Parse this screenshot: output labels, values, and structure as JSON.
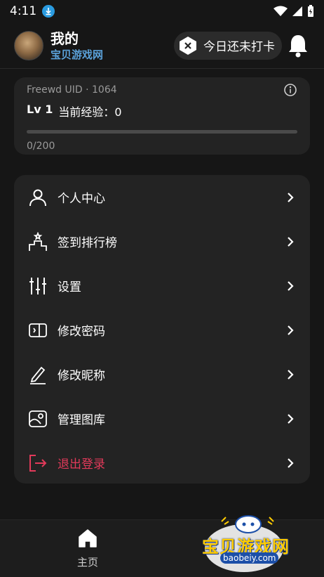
{
  "statusbar": {
    "time": "4:11"
  },
  "header": {
    "title": "我的",
    "subtitle": "宝贝游戏网",
    "checkin_label": "今日还未打卡"
  },
  "level_card": {
    "uid_text": "Freewd UID · 1064",
    "level": "Lv 1",
    "exp_text": "当前经验：0",
    "progress_text": "0/200",
    "progress_fraction": 0
  },
  "menu": {
    "items": [
      {
        "label": "个人中心",
        "icon": "person-icon"
      },
      {
        "label": "签到排行榜",
        "icon": "podium-icon"
      },
      {
        "label": "设置",
        "icon": "sliders-icon"
      },
      {
        "label": "修改密码",
        "icon": "password-icon"
      },
      {
        "label": "修改昵称",
        "icon": "pencil-icon"
      },
      {
        "label": "管理图库",
        "icon": "gallery-icon"
      },
      {
        "label": "退出登录",
        "icon": "logout-icon"
      }
    ]
  },
  "bottom_nav": {
    "tabs": [
      {
        "label": "主页",
        "icon": "home-icon"
      }
    ]
  },
  "watermark": {
    "text": "宝贝游戏网",
    "url": "baobeiy.com"
  },
  "colors": {
    "background": "#161616",
    "card": "#232323",
    "accent_blue": "#5aa0d8",
    "logout_red": "#e23a5a"
  }
}
